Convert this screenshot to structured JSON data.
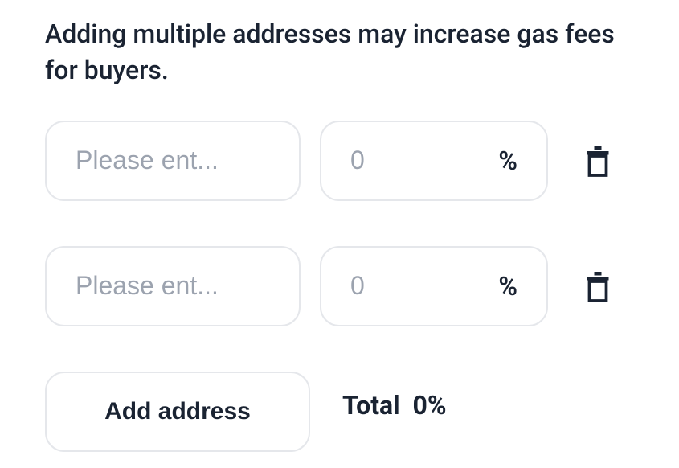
{
  "warning": "Adding multiple addresses may increase gas fees for buyers.",
  "rows": [
    {
      "address_placeholder": "Please ent...",
      "address_value": "",
      "percent_placeholder": "0",
      "percent_value": "",
      "percent_symbol": "%"
    },
    {
      "address_placeholder": "Please ent...",
      "address_value": "",
      "percent_placeholder": "0",
      "percent_value": "",
      "percent_symbol": "%"
    }
  ],
  "add_button_label": "Add address",
  "total_label": "Total",
  "total_value": "0%"
}
